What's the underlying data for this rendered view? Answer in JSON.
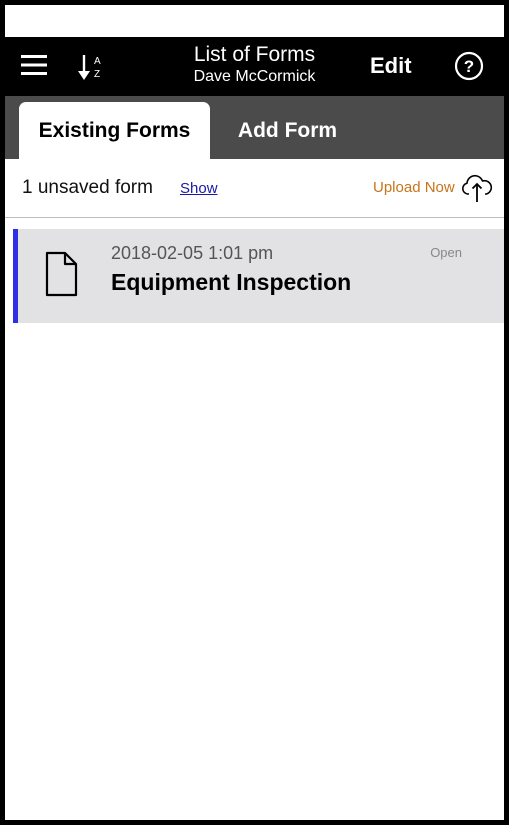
{
  "header": {
    "title": "List of Forms",
    "subtitle": "Dave McCormick",
    "edit_label": "Edit",
    "menu_icon": "hamburger-menu-icon",
    "sort_icon": "sort-a-z-icon",
    "help_icon": "help-circle-icon"
  },
  "tabs": [
    {
      "label": "Existing Forms",
      "active": true
    },
    {
      "label": "Add Form",
      "active": false
    }
  ],
  "unsaved": {
    "text": "1 unsaved form",
    "show_label": "Show",
    "upload_label": "Upload Now",
    "upload_icon": "cloud-upload-icon"
  },
  "forms": [
    {
      "date": "2018-02-05 1:01 pm",
      "name": "Equipment Inspection",
      "status": "Open",
      "icon": "document-icon"
    }
  ],
  "colors": {
    "header_bg": "#000000",
    "tabs_bg": "#4b4b4b",
    "row_bg": "#e2e1e3",
    "row_accent": "#2f2fe6",
    "upload_text": "#c8741a",
    "link": "#1a1aa6"
  }
}
